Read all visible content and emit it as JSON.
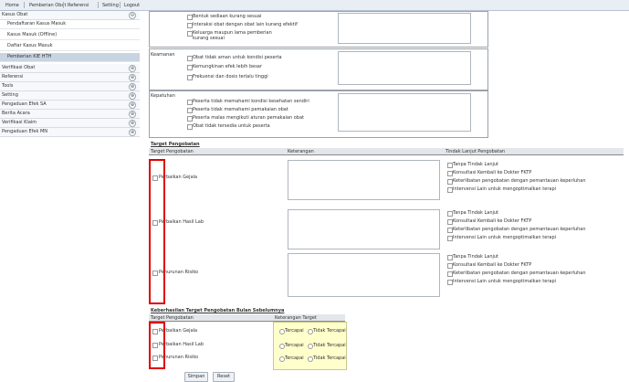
{
  "nav": {
    "tabs": [
      "Home",
      "Pemberian Obat",
      "Referensi",
      "Setting",
      "Logout"
    ]
  },
  "sidebar": {
    "group1": {
      "label": "Kasus Obat"
    },
    "subitems": [
      "Pendaftaran Kasus Masuk",
      "Kasus Masuk (Offline)",
      "Daftar Kasus Masuk",
      "Pemberian KIE HTH"
    ],
    "groups": [
      "Verifikasi Obat",
      "Referensi",
      "Tools",
      "Setting",
      "Pengaduan Efek SA",
      "Berita Acara",
      "Verifikasi Klaim",
      "Pengaduan Efek MN"
    ]
  },
  "sections": {
    "top_block": {
      "options": [
        "Bentuk sediaan kurang sesuai",
        "Interaksi obat dengan obat lain kurang efektif",
        "Keluarga maupun lama pemberian kurang sesuai"
      ]
    },
    "keamanan": {
      "label": "Keamanan",
      "options": [
        "Obat tidak aman untuk kondisi peserta",
        "Kemungkinan efek lebih besar",
        "Frekuensi dan dosis terlalu tinggi"
      ]
    },
    "kepatuhan": {
      "label": "Kepatuhan",
      "options": [
        "Peserta tidak memahami kondisi kesehatan sendiri",
        "Peserta tidak memahami pemakaian obat",
        "Peserta malas mengikuti aturan pemakaian obat",
        "Obat tidak tersedia untuk peserta"
      ]
    }
  },
  "target": {
    "title": "Target Pengobatan",
    "headers": [
      "Target Pengobatan",
      "Keterangan",
      "Tindak Lanjut Pengobatan"
    ],
    "rows": [
      "Perbaikan Gejala",
      "Perbaikan Hasil Lab",
      "Penurunan Risiko"
    ],
    "followup_options": [
      "Tanpa Tindak Lanjut",
      "Konsultasi Kembali ke Dokter FKTP",
      "Keterlibatan pengobatan dengan pemantauan keperluhan",
      "Intervensi Lain untuk mengoptimalkan terapi"
    ]
  },
  "achievement": {
    "title": "Keberhasilan Target Pengobatan Bulan Sebelumnya",
    "headers": [
      "Target Pengobatan",
      "Keterangan Target"
    ],
    "rows": [
      "Perbaikan Gejala",
      "Perbaikan Hasil Lab",
      "Penurunan Risiko"
    ],
    "options": [
      "Tercapai",
      "Tidak Tercapai"
    ]
  },
  "buttons": {
    "save": "Simpan",
    "reset": "Reset"
  }
}
